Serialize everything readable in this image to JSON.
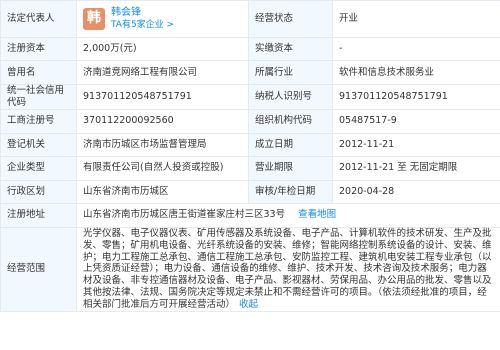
{
  "rows": [
    {
      "l1": "法定代表人",
      "v1": "",
      "l2": "经营状态",
      "v2": "开业"
    },
    {
      "l1": "注册资本",
      "v1": "2,000万(元)",
      "l2": "实缴资本",
      "v2": "-"
    },
    {
      "l1": "曾用名",
      "v1": "济南道竞网络工程有限公司",
      "l2": "所属行业",
      "v2": "软件和信息技术服务业"
    },
    {
      "l1": "统一社会信用代码",
      "v1": "913701120548751791",
      "l2": "纳税人识别号",
      "v2": "913701120548751791"
    },
    {
      "l1": "工商注册号",
      "v1": "370112200092560",
      "l2": "组织机构代码",
      "v2": "05487517-9"
    },
    {
      "l1": "登记机关",
      "v1": "济南市历城区市场监督管理局",
      "l2": "成立日期",
      "v2": "2012-11-21"
    },
    {
      "l1": "企业类型",
      "v1": "有限责任公司(自然人投资或控股)",
      "l2": "营业期限",
      "v2": "2012-11-21 至 无固定期限"
    },
    {
      "l1": "行政区划",
      "v1": "山东省济南市历城区",
      "l2": "审核/年检日期",
      "v2": "2020-04-28"
    }
  ],
  "representative": {
    "avatar_char": "韩",
    "name": "韩会锋",
    "sub": "TA有5家企业 >"
  },
  "address": {
    "label": "注册地址",
    "value": "山东省济南市历城区唐王街道崔家庄村三区33号",
    "map_link": "查看地图"
  },
  "scope": {
    "label": "经营范围",
    "text": "光学仪器、电子仪器仪表、矿用传感器及系统设备、电子产品、计算机软件的技术研发、生产及批发、零售；矿用机电设备、光纤系统设备的安装、维修；智能网络控制系统设备的设计、安装、维护；电力工程施工总承包、通信工程施工总承包、安防监控工程、建筑机电安装工程专业承包（以上凭资质证经营）；电力设备、通信设备的维修、维护、技术开发、技术咨询及技术服务；电力器材及设备、非专控通信器材及设备、电子产品、影视器材、劳保用品、办公用品的批发、零售以及其他按法律、法规、国务院决定等规定未禁止和不需经营许可的项目。（依法须经批准的项目，经相关部门批准后方可开展经营活动）",
    "collapse_label": "收起"
  }
}
